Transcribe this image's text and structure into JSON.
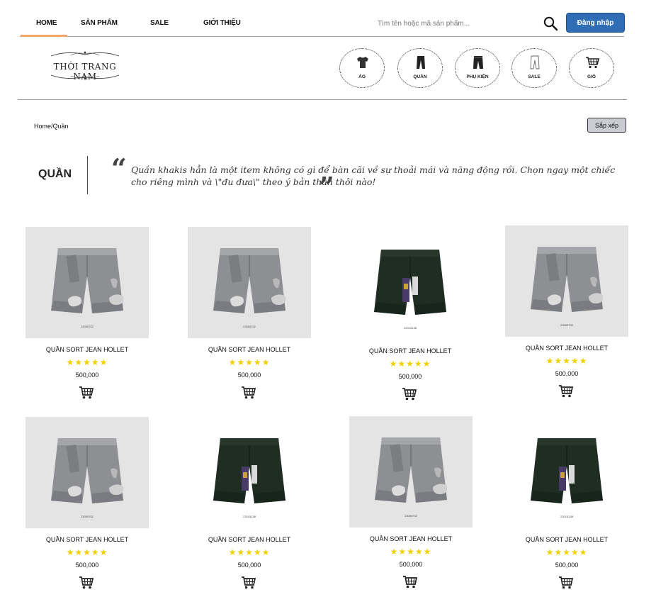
{
  "nav": {
    "items": [
      "HOME",
      "SẢN PHẨM",
      "SALE",
      "GIỚI THIỆU"
    ],
    "active": "HOME",
    "accent_color": "#f2a56a"
  },
  "search": {
    "placeholder": "Tìm tên hoặc mã sản phẩm..."
  },
  "auth": {
    "login_label": "Đăng nhập",
    "login_color": "#2f6db5"
  },
  "brand": {
    "logo_text": "THỜI TRANG NAM"
  },
  "categories": [
    {
      "label": "ÁO",
      "icon": "shirt-icon"
    },
    {
      "label": "QUẦN",
      "icon": "pants-icon"
    },
    {
      "label": "PHỤ KIỆN",
      "icon": "accessory-pants-icon"
    },
    {
      "label": "SALE",
      "icon": "sale-pants-icon"
    },
    {
      "label": "GIỎ",
      "icon": "cart-icon"
    }
  ],
  "breadcrumb": "Home/Quần",
  "sort_label": "Sắp xếp",
  "page_title": "QUẦN",
  "quote": "Quần khakis hẳn là một item không có gì để bàn cãi về sự thoải mái và năng động rồi. Chọn ngay một chiếc cho riêng mình và \\\"đu đưa\\\" theo ý bản thân thôi nào!",
  "products": [
    {
      "name": "QUẦN SORT JEAN HOLLET",
      "stars": "★★★★★",
      "price": "500,000",
      "color": "grey",
      "code": "23000702"
    },
    {
      "name": "QUẦN SORT JEAN HOLLET",
      "stars": "★★★★★",
      "price": "500,000",
      "color": "grey",
      "code": "23000702"
    },
    {
      "name": "QUẦN SORT JEAN HOLLET",
      "stars": "★★★★★",
      "price": "500,000",
      "color": "dark",
      "code": "22015138"
    },
    {
      "name": "QUẦN SORT JEAN HOLLET",
      "stars": "★★★★★",
      "price": "500,000",
      "color": "grey",
      "code": "23000702"
    },
    {
      "name": "QUẦN SORT JEAN HOLLET",
      "stars": "★★★★★",
      "price": "500,000",
      "color": "grey",
      "code": "23000702"
    },
    {
      "name": "QUẦN SORT JEAN HOLLET",
      "stars": "★★★★★",
      "price": "500,000",
      "color": "dark",
      "code": "22015138"
    },
    {
      "name": "QUẦN SORT JEAN HOLLET",
      "stars": "★★★★★",
      "price": "500,000",
      "color": "grey",
      "code": "23000702"
    },
    {
      "name": "QUẦN SORT JEAN HOLLET",
      "stars": "★★★★★",
      "price": "500,000",
      "color": "dark",
      "code": "22015138"
    }
  ]
}
